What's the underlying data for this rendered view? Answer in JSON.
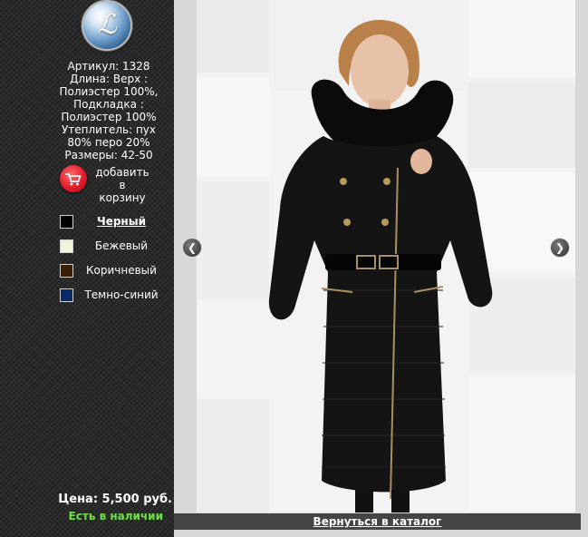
{
  "product": {
    "specs": [
      "Артикул: 1328",
      "Длина: Верх :",
      "Полиэстер 100%,",
      "Подкладка :",
      "Полиэстер 100%",
      "Утеплитель: пух",
      "80% перо 20%",
      "Размеры: 42-50"
    ],
    "price": "Цена: 5,500 руб.",
    "stock_status": "Есть в наличии"
  },
  "cart": {
    "label_line1": "добавить",
    "label_line2": "в корзину"
  },
  "colors": [
    {
      "label": "Черный",
      "swatch": "#000000",
      "selected": true
    },
    {
      "label": "Бежевый",
      "swatch": "#f5f0d8",
      "selected": false
    },
    {
      "label": "Коричневый",
      "swatch": "#3a1e06",
      "selected": false
    },
    {
      "label": "Темно-синий",
      "swatch": "#0b2a66",
      "selected": false
    }
  ],
  "gallery": {
    "prev_icon": "chevron-left-icon",
    "next_icon": "chevron-right-icon"
  },
  "footer": {
    "back_link": "Вернуться в каталог"
  },
  "theme": {
    "stock_color": "#6fe040",
    "cart_color": "#e21b2b"
  }
}
